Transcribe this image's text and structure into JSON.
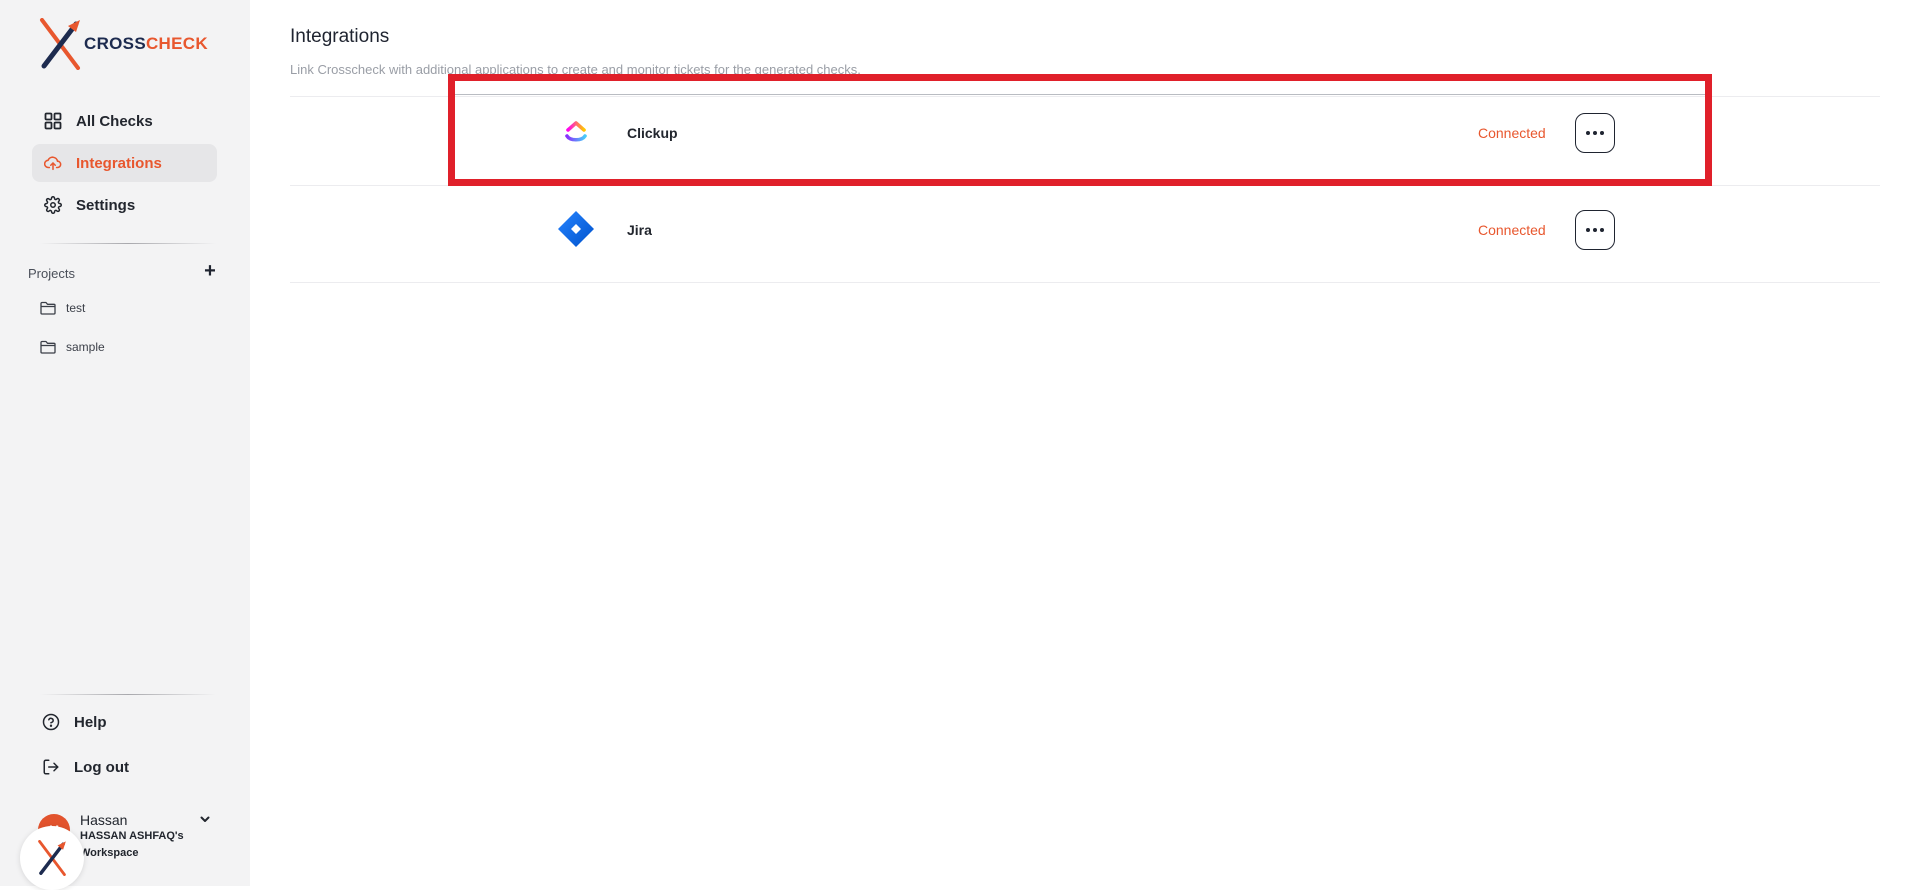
{
  "brand": {
    "name_part1": "CROSS",
    "name_part2": "CHECK",
    "accent_color": "#e8572e",
    "navy_color": "#1d2b4f"
  },
  "sidebar": {
    "nav": [
      {
        "label": "All Checks",
        "icon": "grid-icon"
      },
      {
        "label": "Integrations",
        "icon": "cloud-upload-icon",
        "active": true
      },
      {
        "label": "Settings",
        "icon": "gear-icon"
      }
    ],
    "projects": {
      "label": "Projects",
      "add_label": "+",
      "items": [
        {
          "label": "test",
          "icon": "folder-icon"
        },
        {
          "label": "sample",
          "icon": "folder-icon"
        }
      ]
    },
    "bottom": [
      {
        "label": "Help",
        "icon": "help-circle-icon"
      },
      {
        "label": "Log out",
        "icon": "logout-icon"
      }
    ],
    "user": {
      "initial": "H",
      "name": "Hassan",
      "workspace_line1": "HASSAN ASHFAQ's",
      "workspace_line2": "Workspace"
    }
  },
  "main": {
    "title": "Integrations",
    "subtitle": "Link Crosscheck with additional applications to create and monitor tickets for the generated checks.",
    "integrations": [
      {
        "name": "Clickup",
        "status": "Connected",
        "icon": "clickup-logo-icon",
        "highlighted": true
      },
      {
        "name": "Jira",
        "status": "Connected",
        "icon": "jira-logo-icon"
      }
    ]
  }
}
